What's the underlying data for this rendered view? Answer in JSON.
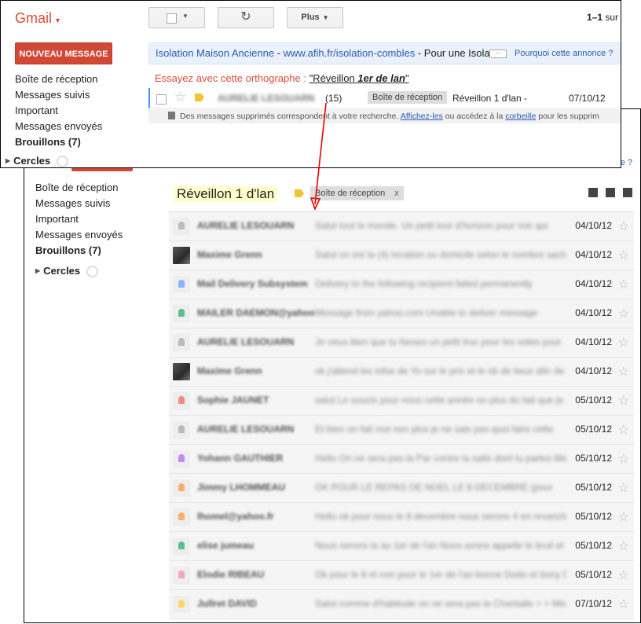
{
  "front": {
    "logo": "Gmail",
    "compose": "NOUVEAU MESSAGE",
    "toolbar": {
      "refresh_icon": "↻",
      "more_label": "Plus"
    },
    "pager": {
      "range": "1–1",
      "suffix": "sur"
    },
    "nav": [
      {
        "label": "Boîte de réception",
        "bold": false
      },
      {
        "label": "Messages suivis",
        "bold": false
      },
      {
        "label": "Important",
        "bold": false
      },
      {
        "label": "Messages envoyés",
        "bold": false
      },
      {
        "label": "Brouillons (7)",
        "bold": true
      }
    ],
    "circles": "Cercles",
    "ad": {
      "title": "Isolation Maison Ancienne",
      "sep": " - ",
      "url": "www.afih.fr/isolation-combles",
      "tail": " - Pour une Isola",
      "more": "···",
      "why": "Pourquoi cette annonce ?"
    },
    "spell": {
      "prefix": "Essayez avec cette orthographe : ",
      "q_open": "\"Réveillon ",
      "q_italic": "1er de lan",
      "q_close": "\""
    },
    "mail": {
      "count": "(15)",
      "label": "Boîte de réception",
      "subject": "Réveillon 1 d'lan -",
      "date": "07/10/12"
    },
    "deleted": {
      "prefix": "Des messages supprimés correspondent à votre recherche. ",
      "link1": "Affichez-les",
      "mid": " ou accédez à la ",
      "link2": "corbeille",
      "suffix": " pour les supprim"
    }
  },
  "back": {
    "ad_peek": "e ?",
    "nav": [
      {
        "label": "Boîte de réception"
      },
      {
        "label": "Messages suivis"
      },
      {
        "label": "Important"
      },
      {
        "label": "Messages envoyés"
      },
      {
        "label": "Brouillons (7)"
      }
    ],
    "circles": "Cercles",
    "conversation": {
      "title": "Réveillon 1 d'lan",
      "label": "Boîte de réception",
      "remove": "x"
    },
    "messages": [
      {
        "avatar": "generic",
        "color": "#bbbbbb",
        "sender": "AURELIE LESOUARN",
        "snippet": "Salut tout le monde. Un petit tour d'horizon pour voir qui",
        "date": "04/10/12"
      },
      {
        "avatar": "photo",
        "color": "#555555",
        "sender": "Maxime Grenn",
        "snippet": "Salut on est la (4) location ou domicile selon le nombre sachez",
        "date": "04/10/12"
      },
      {
        "avatar": "generic",
        "color": "#8ab4f8",
        "sender": "Mail Delivery Subsystem",
        "snippet": "Delivery to the following recipient failed permanently",
        "date": "04/10/12"
      },
      {
        "avatar": "generic",
        "color": "#5bc08a",
        "sender": "MAILER DAEMON@yahoo.com",
        "snippet": "Message from yahoo.com Unable to deliver message",
        "date": "04/10/12"
      },
      {
        "avatar": "generic",
        "color": "#bbbbbb",
        "sender": "AURELIE LESOUARN",
        "snippet": "Je veux bien que tu fasses un petit truc pour les votes pour",
        "date": "04/10/12"
      },
      {
        "avatar": "photo",
        "color": "#555555",
        "sender": "Maxime Grenn",
        "snippet": "ok j'attend les infos de Yo sur le prix et le nb de lieux afin de faire",
        "date": "04/10/12"
      },
      {
        "avatar": "generic",
        "color": "#f28b82",
        "sender": "Sophie JAUNET",
        "snippet": "salut Le soucis pour nous cette année on plus du fait que je ne",
        "date": "05/10/12"
      },
      {
        "avatar": "generic",
        "color": "#bbbbbb",
        "sender": "AURELIE LESOUARN",
        "snippet": "Et bien on fait moi non plus je ne sais pas quoi faire cette",
        "date": "05/10/12"
      },
      {
        "avatar": "generic",
        "color": "#c58af9",
        "sender": "Yohann GAUTHIER",
        "snippet": "Hello On ne sera pas la Par contre la salle dont tu parles lilie",
        "date": "05/10/12"
      },
      {
        "avatar": "generic",
        "color": "#f6b26b",
        "sender": "Jimmy LHOMMEAU",
        "snippet": "OK POUR LE REPAS DE NOEL LE 8 DECEMBRE (pour",
        "date": "05/10/12"
      },
      {
        "avatar": "generic",
        "color": "#f6b26b",
        "sender": "lhomel@yahoo.fr",
        "snippet": "Hello ok pour nous le 8 decembre nous serons 4 en revanche",
        "date": "05/10/12"
      },
      {
        "avatar": "generic",
        "color": "#5bc08a",
        "sender": "elise jumeau",
        "snippet": "Nous serons la au 1er de l'an Nous avons appelle le bruil et Tresse",
        "date": "05/10/12"
      },
      {
        "avatar": "generic",
        "color": "#f4a7b9",
        "sender": "Elodie RIBEAU",
        "snippet": "Ok pour le 8 et non pour le 1er de l'an bonne Dodo et bony De",
        "date": "05/10/12"
      },
      {
        "avatar": "generic",
        "color": "#ffd666",
        "sender": "Jullret DAVID",
        "snippet": "Salut comme d'habitude on ne sera pas la Chantalle > > Message",
        "date": "07/10/12"
      }
    ]
  }
}
